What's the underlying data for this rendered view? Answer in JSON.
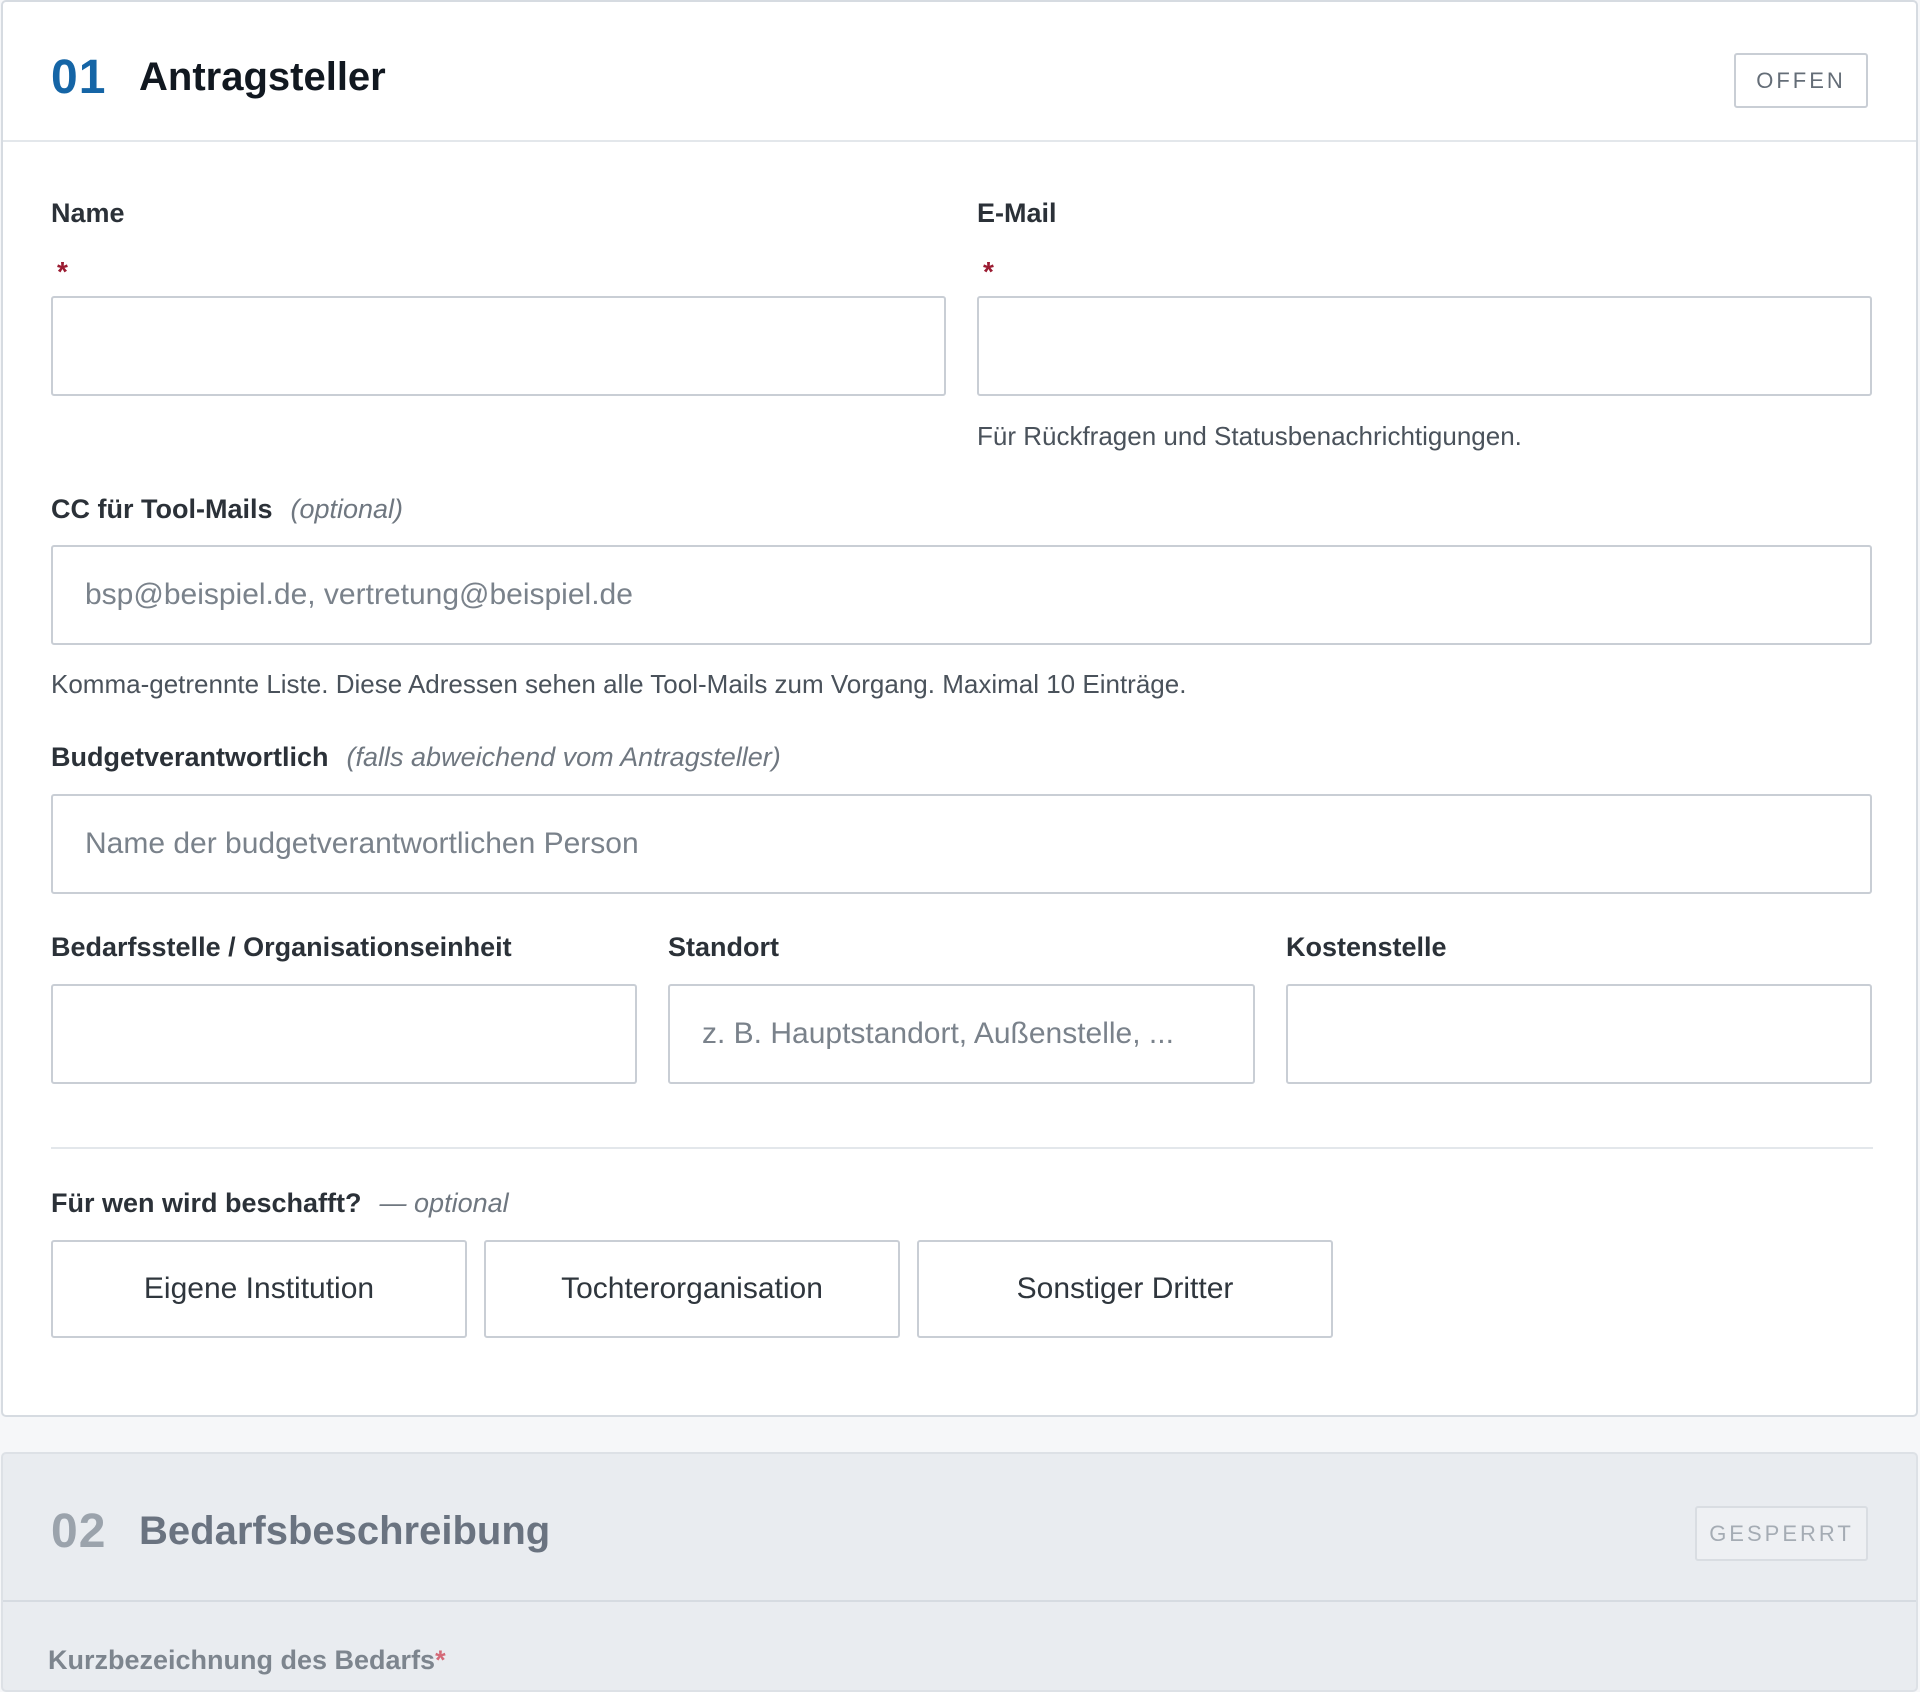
{
  "section1": {
    "number": "01",
    "title": "Antragsteller",
    "status": "OFFEN",
    "fields": {
      "name_label": "Name",
      "email_label": "E-Mail",
      "required_marker": "*",
      "email_help": "Für Rückfragen und Statusbenachrichtigungen.",
      "cc_label": "CC für Tool-Mails",
      "cc_hint": "(optional)",
      "cc_placeholder": "bsp@beispiel.de, vertretung@beispiel.de",
      "cc_help": "Komma-getrennte Liste. Diese Adressen sehen alle Tool-Mails zum Vorgang. Maximal 10 Einträge.",
      "budget_label": "Budgetverantwortlich",
      "budget_hint": "(falls abweichend vom Antragsteller)",
      "budget_placeholder": "Name der budgetverantwortlichen Person",
      "org_label": "Bedarfsstelle / Organisationseinheit",
      "location_label": "Standort",
      "location_placeholder": "z. B. Hauptstandort, Außenstelle, ...",
      "cost_label": "Kostenstelle"
    },
    "procurement": {
      "question": "Für wen wird beschafft?",
      "hint": "— optional",
      "options": [
        "Eigene Institution",
        "Tochterorganisation",
        "Sonstiger Dritter"
      ]
    }
  },
  "section2": {
    "number": "02",
    "title": "Bedarfsbeschreibung",
    "status": "GESPERRT",
    "field_label": "Kurzbezeichnung des Bedarfs",
    "required_marker": "*"
  }
}
